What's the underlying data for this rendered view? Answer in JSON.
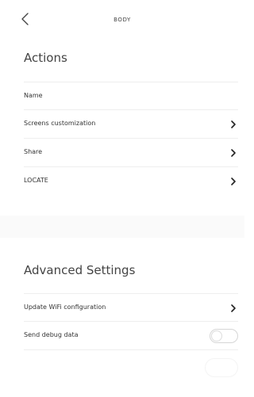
{
  "header": {
    "title": "BODY",
    "back_icon": "chevron-left-icon"
  },
  "actions": {
    "title": "Actions",
    "items": [
      {
        "label": "Name",
        "has_chevron": false
      },
      {
        "label": "Screens customization",
        "has_chevron": true
      },
      {
        "label": "Share",
        "has_chevron": true
      },
      {
        "label": "LOCATE",
        "has_chevron": true
      }
    ]
  },
  "advanced": {
    "title": "Advanced Settings",
    "items": [
      {
        "label": "Update WiFi configuration",
        "has_chevron": true
      },
      {
        "label": "Send debug data",
        "toggle": false
      }
    ]
  },
  "colors": {
    "text": "#333333",
    "divider": "#eeeeee",
    "section_gap": "#fafafa"
  }
}
